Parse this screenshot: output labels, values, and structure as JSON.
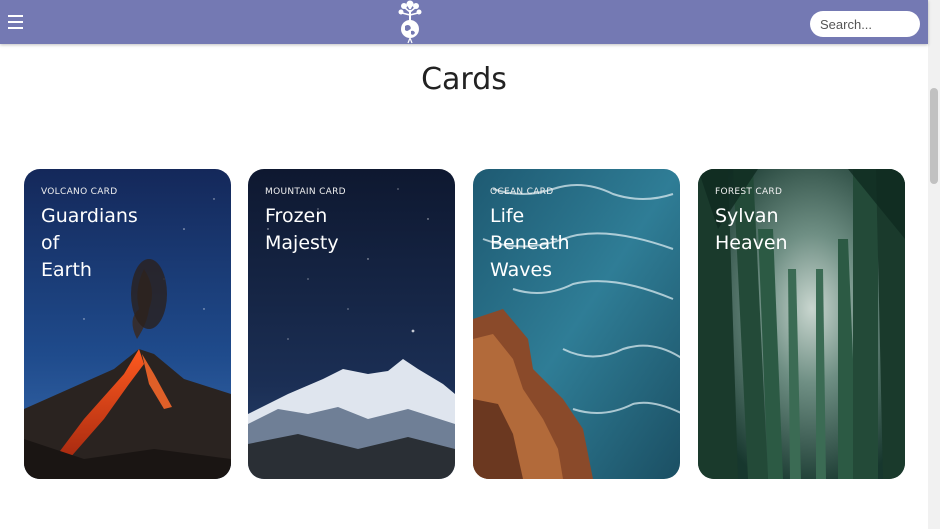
{
  "header": {
    "menu_icon": "hamburger-menu-icon",
    "logo_icon": "tree-globe-logo-icon",
    "search_placeholder": "Search..."
  },
  "page": {
    "title": "Cards"
  },
  "cards": [
    {
      "category": "VOLCANO CARD",
      "title": "Guardians\nof\nEarth",
      "image": "volcano-eruption-night"
    },
    {
      "category": "MOUNTAIN CARD",
      "title": "Frozen\nMajesty",
      "image": "snowy-mountain-starry-sky"
    },
    {
      "category": "OCEAN CARD",
      "title": "Life\nBeneath\nWaves",
      "image": "ocean-waves-rocky-shore"
    },
    {
      "category": "FOREST CARD",
      "title": "Sylvan\nHeaven",
      "image": "tall-forest-trees"
    }
  ],
  "colors": {
    "navbar": "#7479b3",
    "background": "#ffffff"
  }
}
